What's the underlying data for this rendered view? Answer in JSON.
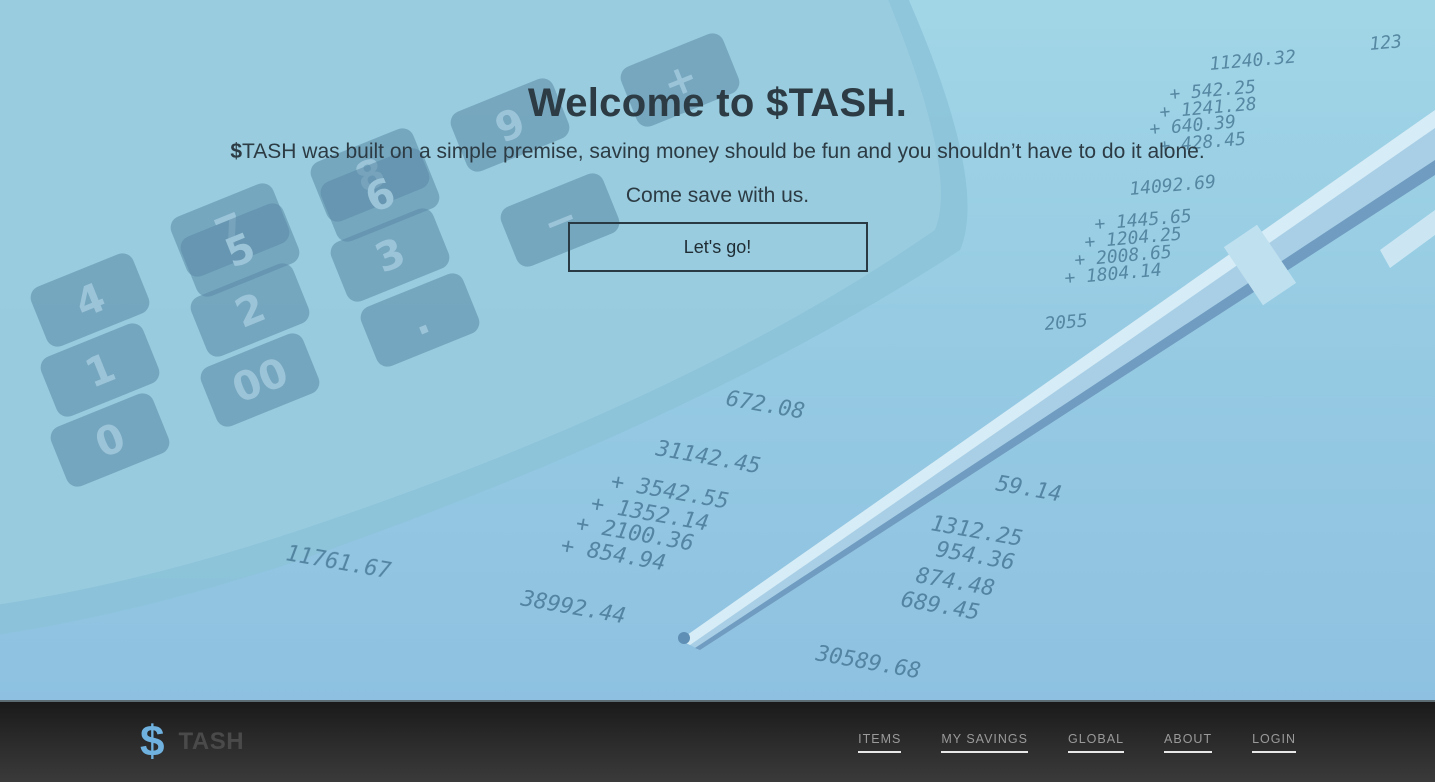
{
  "hero": {
    "title": "Welcome to $TASH.",
    "subtitle_dollar": "$",
    "subtitle_rest": "TASH was built on a simple premise, saving money should be fun and you shouldn’t have to do it alone.",
    "tagline": "Come save with us.",
    "cta_label": "Let's go!"
  },
  "background": {
    "calculator_keys": [
      "7",
      "8",
      "9",
      "4",
      "5",
      "6",
      "1",
      "2",
      "3",
      "0",
      "00",
      ".",
      "+",
      "−"
    ],
    "ledger_numbers": [
      "123",
      "11240.32",
      "+ 542.25",
      "+ 1241.28",
      "+ 640.39",
      "+ 428.45",
      "14092.69",
      "+ 1445.65",
      "+ 1204.25",
      "+ 2008.65",
      "+ 1804.14",
      "2055",
      "31142.45",
      "+ 3542.55",
      "+ 1352.14",
      "+ 2100.36",
      "+ 854.94",
      "38992.44",
      "59.14",
      "1312.25",
      "954.36",
      "874.48",
      "689.45",
      "30589.68",
      "672.08",
      "11761.67"
    ]
  },
  "navbar": {
    "brand_dollar": "$",
    "brand_text": "TASH",
    "links": [
      {
        "label": "ITEMS"
      },
      {
        "label": "MY SAVINGS"
      },
      {
        "label": "GLOBAL"
      },
      {
        "label": "ABOUT"
      },
      {
        "label": "LOGIN"
      }
    ]
  },
  "colors": {
    "hero_overlay": "#8dc4e0",
    "brand_accent": "#6fb2e0",
    "navbar_bg": "#2b2b2b",
    "heading_text": "#2c3b44"
  }
}
